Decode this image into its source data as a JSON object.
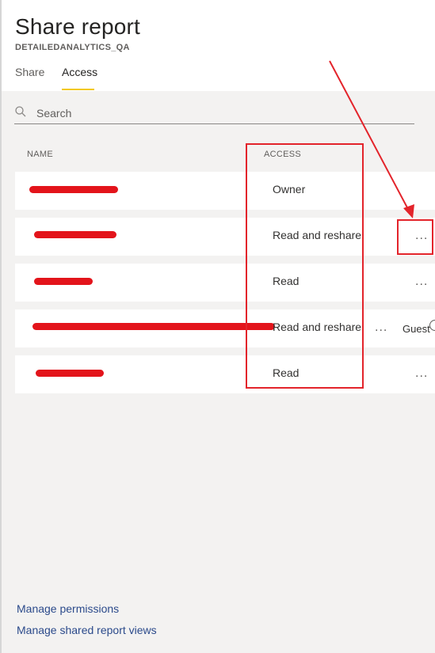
{
  "dialog": {
    "title": "Share report",
    "subtitle": "DETAILEDANALYTICS_QA"
  },
  "tabs": [
    {
      "label": "Share",
      "active": false
    },
    {
      "label": "Access",
      "active": true
    }
  ],
  "search": {
    "placeholder": "Search",
    "value": ""
  },
  "columns": {
    "name": "NAME",
    "access": "ACCESS"
  },
  "rows": [
    {
      "name_redacted": true,
      "access": "Owner",
      "more": "",
      "guest": ""
    },
    {
      "name_redacted": true,
      "access": "Read and reshare",
      "more": "...",
      "guest": ""
    },
    {
      "name_redacted": true,
      "access": "Read",
      "more": "...",
      "guest": ""
    },
    {
      "name_redacted": true,
      "access": "Read and reshare",
      "more": "...",
      "guest": "Guest"
    },
    {
      "name_redacted": true,
      "access": "Read",
      "more": "...",
      "guest": ""
    }
  ],
  "footer": {
    "manage_permissions": "Manage permissions",
    "manage_shared_views": "Manage shared report views"
  },
  "colors": {
    "accent": "#f2c811",
    "annotation": "#e3242b",
    "link": "#2b4a8b",
    "panel_background": "#f3f2f1"
  }
}
